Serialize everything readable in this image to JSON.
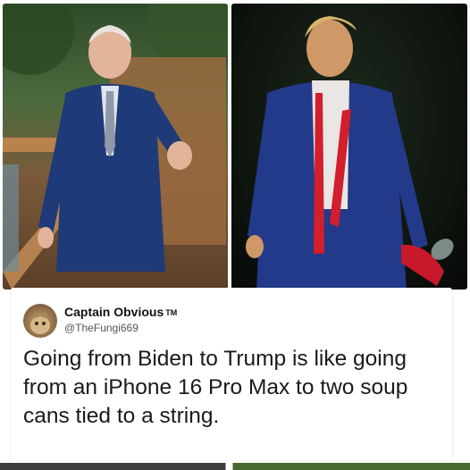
{
  "tweet": {
    "display_name": "Captain Obvious",
    "trademark": "TM",
    "handle": "@TheFungi669",
    "text": "Going from Biden to Trump is like going from an iPhone 16 Pro Max to two soup cans tied to a string."
  },
  "colors": {
    "suit_left": "#1f3a78",
    "suit_right": "#233a8a",
    "tie_right": "#d21f2b",
    "card_bg": "#ffffff",
    "text": "#1a1a1a",
    "handle": "#555555"
  }
}
